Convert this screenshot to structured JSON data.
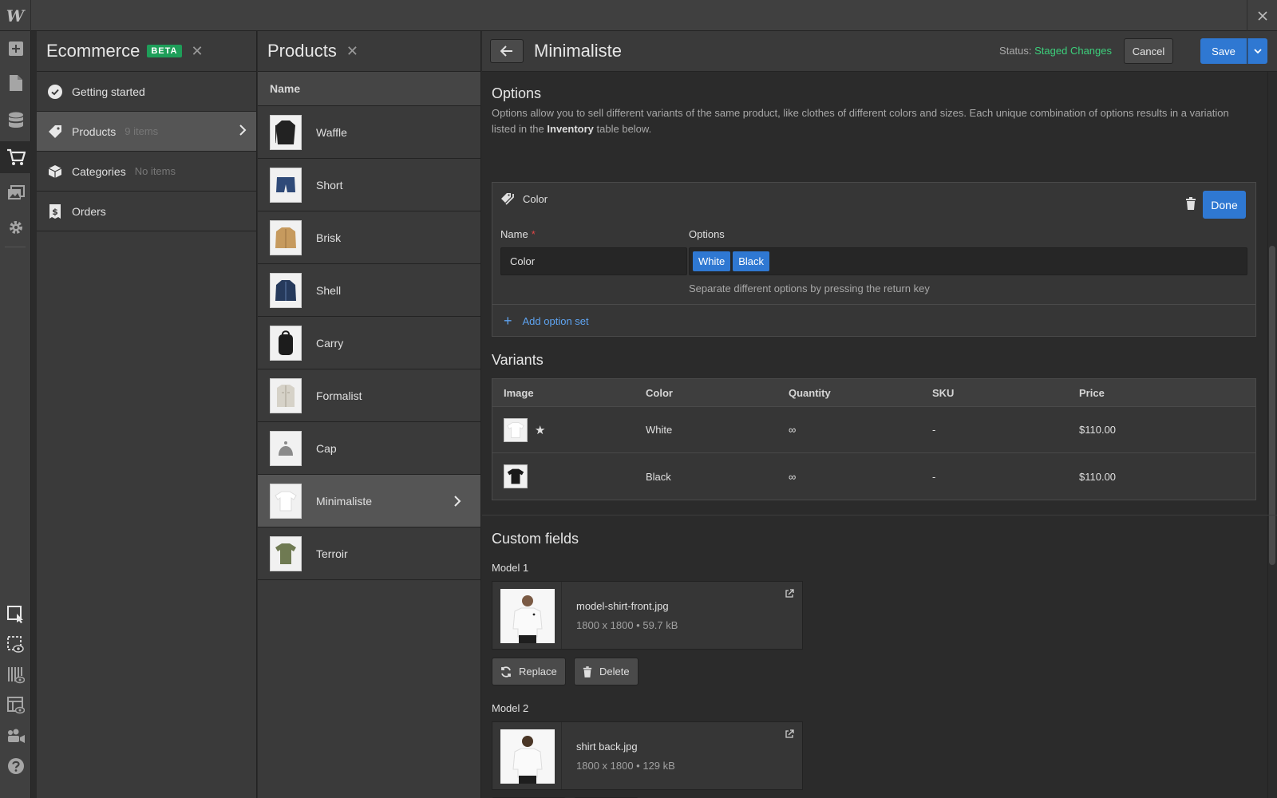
{
  "app": {
    "logo": "W"
  },
  "ecommerce_panel": {
    "title": "Ecommerce",
    "badge": "BETA",
    "items": [
      {
        "label": "Getting started",
        "count": ""
      },
      {
        "label": "Products",
        "count": "9 items"
      },
      {
        "label": "Categories",
        "count": "No items"
      },
      {
        "label": "Orders",
        "count": ""
      }
    ]
  },
  "products_panel": {
    "title": "Products",
    "column_header": "Name",
    "items": [
      "Waffle",
      "Short",
      "Brisk",
      "Shell",
      "Carry",
      "Formalist",
      "Cap",
      "Minimaliste",
      "Terroir"
    ]
  },
  "editor": {
    "title": "Minimaliste",
    "status_label": "Status:",
    "status_value": "Staged Changes",
    "cancel_label": "Cancel",
    "save_label": "Save",
    "options": {
      "title": "Options",
      "description_1": "Options allow you to sell different variants of the same product, like clothes of different colors and sizes. Each unique combination of options results in a variation listed in the",
      "description_bold": "Inventory",
      "description_2": "table below.",
      "set_label": "Color",
      "done_label": "Done",
      "name_label": "Name",
      "required_mark": "*",
      "options_label": "Options",
      "name_value": "Color",
      "tags": [
        "White",
        "Black"
      ],
      "hint": "Separate different options by pressing the return key",
      "add_set_label": "Add option set"
    },
    "variants": {
      "title": "Variants",
      "columns": [
        "Image",
        "Color",
        "Quantity",
        "SKU",
        "Price"
      ],
      "rows": [
        {
          "color": "White",
          "quantity": "∞",
          "sku": "-",
          "price": "$110.00",
          "default": "★"
        },
        {
          "color": "Black",
          "quantity": "∞",
          "sku": "-",
          "price": "$110.00",
          "default": ""
        }
      ]
    },
    "custom_fields": {
      "title": "Custom fields",
      "models": [
        {
          "label": "Model 1",
          "file_name": "model-shirt-front.jpg",
          "meta": "1800 x 1800 • 59.7 kB"
        },
        {
          "label": "Model 2",
          "file_name": "shirt back.jpg",
          "meta": "1800 x 1800 • 129 kB"
        }
      ],
      "replace_label": "Replace",
      "delete_label": "Delete"
    }
  },
  "colors": {
    "accent": "#2f78d2",
    "status_green": "#3ccf7b",
    "beta_green": "#1e9e59",
    "link_blue": "#5ea3f0"
  }
}
